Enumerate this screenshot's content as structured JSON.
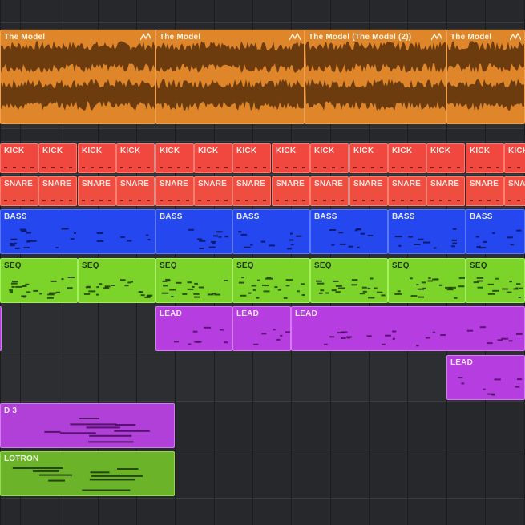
{
  "tracks": [
    {
      "id": "audio",
      "kind": "audio",
      "color": "#e0862a",
      "border": "#f0a150",
      "text_color": "#fff3e0",
      "clips": [
        {
          "label": "The Model",
          "fade_icon": "fade-icon"
        },
        {
          "label": "The Model",
          "fade_icon": "fade-icon"
        },
        {
          "label": "The Model (The Model (2))",
          "fade_icon": "fade-icon"
        },
        {
          "label": "The Model",
          "fade_icon": "fade-icon"
        }
      ]
    },
    {
      "id": "kick",
      "kind": "drum",
      "color": "#f0473e",
      "border": "#ff7a70",
      "text_color": "#ffe6e4",
      "clips": [
        {
          "label": "KICK"
        },
        {
          "label": "KICK"
        },
        {
          "label": "KICK"
        },
        {
          "label": "KICK"
        },
        {
          "label": "KICK"
        },
        {
          "label": "KICK"
        },
        {
          "label": "KICK"
        },
        {
          "label": "KICK"
        },
        {
          "label": "KICK"
        },
        {
          "label": "KICK"
        },
        {
          "label": "KICK"
        },
        {
          "label": "KICK"
        },
        {
          "label": "KICK"
        },
        {
          "label": "KICK"
        }
      ]
    },
    {
      "id": "snare",
      "kind": "drum",
      "color": "#ef4d3f",
      "border": "#ff7f70",
      "text_color": "#ffe6e4",
      "clips": [
        {
          "label": "SNARE"
        },
        {
          "label": "SNARE"
        },
        {
          "label": "SNARE"
        },
        {
          "label": "SNARE"
        },
        {
          "label": "SNARE"
        },
        {
          "label": "SNARE"
        },
        {
          "label": "SNARE"
        },
        {
          "label": "SNARE"
        },
        {
          "label": "SNARE"
        },
        {
          "label": "SNARE"
        },
        {
          "label": "SNARE"
        },
        {
          "label": "SNARE"
        },
        {
          "label": "SNARE"
        },
        {
          "label": "SNARE"
        }
      ]
    },
    {
      "id": "bass",
      "kind": "midi",
      "color": "#2447f0",
      "border": "#5b78ff",
      "text_color": "#e4e9ff",
      "clips": [
        {
          "label": "BASS"
        },
        {
          "label": "BASS"
        },
        {
          "label": "BASS"
        },
        {
          "label": "BASS"
        },
        {
          "label": "BASS"
        },
        {
          "label": "BASS"
        }
      ]
    },
    {
      "id": "seq",
      "kind": "midi",
      "color": "#7cd42a",
      "border": "#a6ef5e",
      "text_color": "#1e3a05",
      "clips": [
        {
          "label": "SEQ"
        },
        {
          "label": "SEQ"
        },
        {
          "label": "SEQ"
        },
        {
          "label": "SEQ"
        },
        {
          "label": "SEQ"
        },
        {
          "label": "SEQ"
        },
        {
          "label": "SEQ"
        }
      ]
    },
    {
      "id": "lead",
      "kind": "midi",
      "color": "#b63de0",
      "border": "#d77bf5",
      "text_color": "#f6e4ff",
      "clips": [
        {
          "label": ""
        },
        {
          "label": "LEAD"
        },
        {
          "label": "LEAD"
        },
        {
          "label": "LEAD"
        }
      ]
    },
    {
      "id": "lead2",
      "kind": "midi",
      "color": "#b63de0",
      "border": "#d77bf5",
      "text_color": "#f6e4ff",
      "clips": [
        {
          "label": "LEAD"
        }
      ]
    },
    {
      "id": "lead3",
      "kind": "midi",
      "color": "#b040d8",
      "border": "#d47cf2",
      "text_color": "#f6e4ff",
      "clips": [
        {
          "label": "D 3"
        }
      ]
    },
    {
      "id": "mellotron",
      "kind": "midi",
      "color": "#6bb42a",
      "border": "#95d85a",
      "text_color": "#eef9e2",
      "clips": [
        {
          "label": "LOTRON"
        }
      ]
    }
  ]
}
